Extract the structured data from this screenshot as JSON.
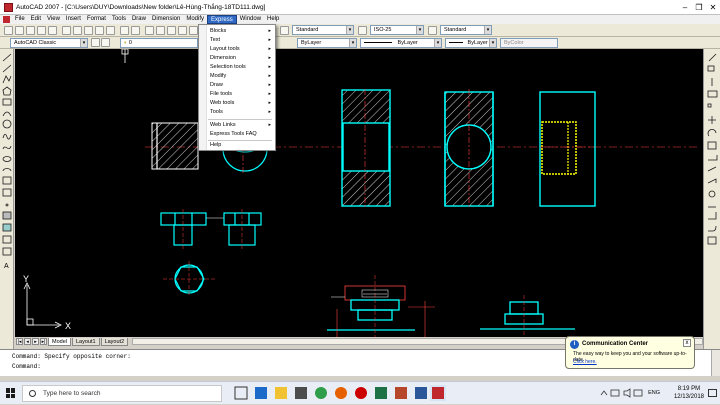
{
  "window": {
    "title": "AutoCAD 2007 - [C:\\Users\\DUY\\Downloads\\New folder\\Lê-Hùng-Thắng-18TD111.dwg]",
    "minimize": "–",
    "maximize": "❐",
    "close": "✕"
  },
  "menubar": {
    "items": [
      "File",
      "Edit",
      "View",
      "Insert",
      "Format",
      "Tools",
      "Draw",
      "Dimension",
      "Modify",
      "Express",
      "Window",
      "Help"
    ],
    "active_index": 9
  },
  "express_menu": {
    "items": [
      "Blocks",
      "Text",
      "Layout tools",
      "Dimension",
      "Selection tools",
      "Modify",
      "Draw",
      "File tools",
      "Web tools",
      "Tools",
      "Web Links",
      "Express Tools FAQ",
      "Help"
    ],
    "submenu_marker": "▸"
  },
  "toolbar": {
    "text_style": "Standard",
    "dim_style": "ISO-25",
    "table_style": "Standard",
    "workspace": "AutoCAD Classic",
    "layer": "0",
    "color": "ByLayer",
    "linetype": "ByLayer",
    "lineweight": "ByLayer",
    "plotstyle": "ByColor",
    "combo_arrow": "▾"
  },
  "tabs": {
    "nav": [
      "|◂",
      "◂",
      "▸",
      "▸|"
    ],
    "items": [
      "Model",
      "Layout1",
      "Layout2"
    ],
    "active_index": 0
  },
  "ucs": {
    "x_label": "X",
    "y_label": "Y"
  },
  "command": {
    "line1": "Command: Specify opposite corner:",
    "line2": "Command:"
  },
  "balloon": {
    "title": "Communication Center",
    "message": "The easy way to keep you and your software up-to-date.",
    "link": "Click here.",
    "close": "x",
    "icon": "i"
  },
  "taskbar": {
    "search_placeholder": "Type here to search",
    "time": "8:19 PM",
    "date": "12/13/2018",
    "lang": "ENG"
  },
  "colors": {
    "canvas": "#000000",
    "cyan": "#00ffff",
    "yellow": "#ffff00",
    "red": "#ff0000",
    "white": "#ffffff",
    "menu_highlight": "#316ac5"
  }
}
